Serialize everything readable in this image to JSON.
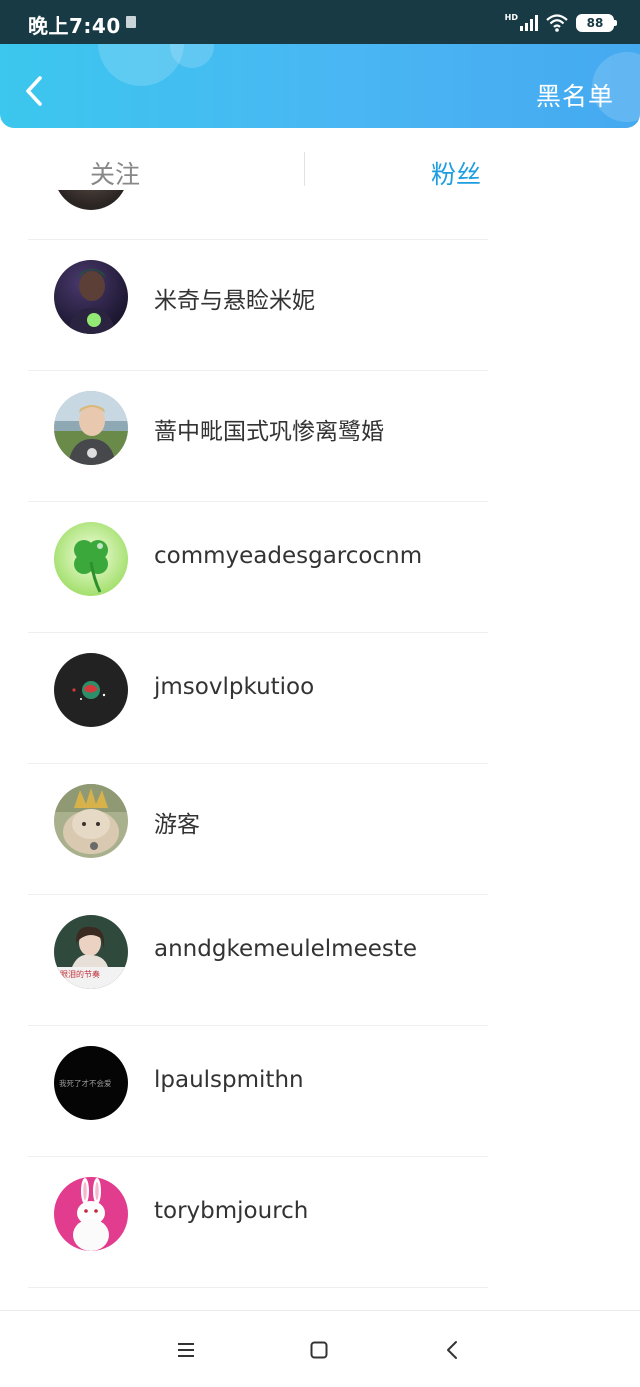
{
  "status_bar": {
    "time": "晚上7:40",
    "signal_label": "HD",
    "battery": "88",
    "icons": [
      "sim-icon",
      "signal-icon",
      "wifi-icon",
      "battery-icon"
    ]
  },
  "header": {
    "back_icon": "chevron-left-icon",
    "blacklist_label": "黑名单"
  },
  "tabs": {
    "follow_label": "关注",
    "fans_label": "粉丝",
    "active": "fans",
    "active_color": "#1e9ee0",
    "inactive_color": "#888888"
  },
  "fans": [
    {
      "name": "米奇与悬睑米妮",
      "avatar": "dark-portrait"
    },
    {
      "name": "蔷中毗国式巩惨离鹭婚",
      "avatar": "boy-photo"
    },
    {
      "name": "commyeadesgarcocnm",
      "avatar": "clover"
    },
    {
      "name": "jmsovlpkutioo",
      "avatar": "dark-logo"
    },
    {
      "name": "游客",
      "avatar": "cat"
    },
    {
      "name": "anndgkemeulelmeeste",
      "avatar": "girl"
    },
    {
      "name": "lpaulspmithn",
      "avatar": "black-text"
    },
    {
      "name": "torybmjourch",
      "avatar": "rabbit"
    }
  ],
  "avatar_texts": {
    "girl_caption": "眼泪的节奏",
    "black_caption": "我死了才不会爱"
  },
  "nav_bar": {
    "icons": [
      "menu-icon",
      "home-square-icon",
      "back-triangle-icon"
    ]
  },
  "colors": {
    "header_gradient_start": "#3bc7ee",
    "header_gradient_end": "#45a9f0",
    "status_bar": "#173a44"
  }
}
